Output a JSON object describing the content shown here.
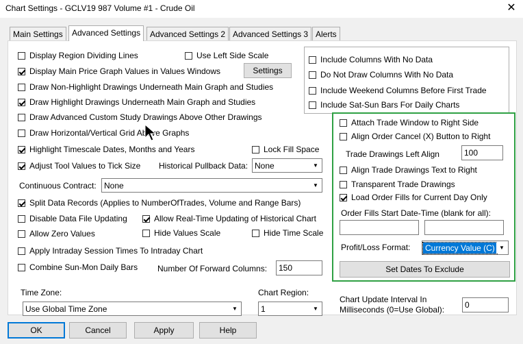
{
  "window": {
    "title": "Chart Settings - GCLV19  987 Volume  #1 - Crude Oil",
    "close_label": "✕"
  },
  "tabs": [
    {
      "label": "Main Settings"
    },
    {
      "label": "Advanced Settings"
    },
    {
      "label": "Advanced Settings 2"
    },
    {
      "label": "Advanced Settings 3"
    },
    {
      "label": "Alerts"
    }
  ],
  "left": {
    "display_region_dividing_lines": "Display Region Dividing Lines",
    "use_left_side_scale": "Use Left Side Scale",
    "display_main_price_values": "Display Main Price Graph Values in Values Windows",
    "settings_button": "Settings",
    "draw_non_highlight": "Draw Non-Highlight Drawings Underneath Main Graph and Studies",
    "draw_highlight": "Draw Highlight Drawings Underneath Main Graph and Studies",
    "draw_advanced_custom": "Draw Advanced Custom Study Drawings Above Other Drawings",
    "draw_grid_above": "Draw Horizontal/Vertical Grid Above Graphs",
    "highlight_timescale": "Highlight Timescale Dates, Months and Years",
    "lock_fill_space": "Lock Fill Space",
    "adjust_tool_values": "Adjust Tool Values to Tick Size",
    "historical_pullback_label": "Historical Pullback Data:",
    "historical_pullback_value": "None",
    "continuous_contract_label": "Continuous Contract:",
    "continuous_contract_value": "None",
    "split_data_records": "Split Data Records (Applies to NumberOfTrades, Volume and Range Bars)",
    "disable_data_file_updating": "Disable Data File Updating",
    "allow_realtime_updating": "Allow Real-Time Updating of Historical Chart",
    "allow_zero_values": "Allow Zero Values",
    "hide_values_scale": "Hide Values Scale",
    "hide_time_scale": "Hide Time Scale",
    "apply_intraday_session": "Apply Intraday Session Times To Intraday Chart",
    "combine_sun_mon": "Combine Sun-Mon Daily Bars",
    "forward_columns_label": "Number Of Forward Columns:",
    "forward_columns_value": "150",
    "time_zone_label": "Time Zone:",
    "time_zone_value": "Use Global Time Zone",
    "chart_region_label": "Chart Region:",
    "chart_region_value": "1"
  },
  "right_top": {
    "include_columns_no_data": "Include Columns With No Data",
    "do_not_draw_columns": "Do Not Draw Columns With No Data",
    "include_weekend_columns": "Include Weekend Columns Before First Trade",
    "include_sat_sun_bars": "Include Sat-Sun Bars For Daily Charts"
  },
  "trade": {
    "attach_trade_window": "Attach Trade Window to Right Side",
    "align_order_cancel": "Align Order Cancel (X) Button to Right",
    "left_align_label": "Trade Drawings Left Align",
    "left_align_value": "100",
    "align_trade_text": "Align Trade Drawings Text to Right",
    "transparent_trade": "Transparent Trade Drawings",
    "load_order_fills": "Load Order Fills for Current Day Only",
    "order_fills_start_label": "Order Fills Start Date-Time (blank for all):",
    "profit_loss_label": "Profit/Loss Format:",
    "profit_loss_value": "Currency Value (C)",
    "set_dates_button": "Set Dates To Exclude"
  },
  "update_interval": {
    "label_line1": "Chart Update Interval In",
    "label_line2": "Milliseconds (0=Use Global):",
    "value": "0"
  },
  "buttons": {
    "ok": "OK",
    "cancel": "Cancel",
    "apply": "Apply",
    "help": "Help"
  },
  "colors": {
    "highlight_green": "#2ea043",
    "selection_blue": "#0078d7"
  }
}
